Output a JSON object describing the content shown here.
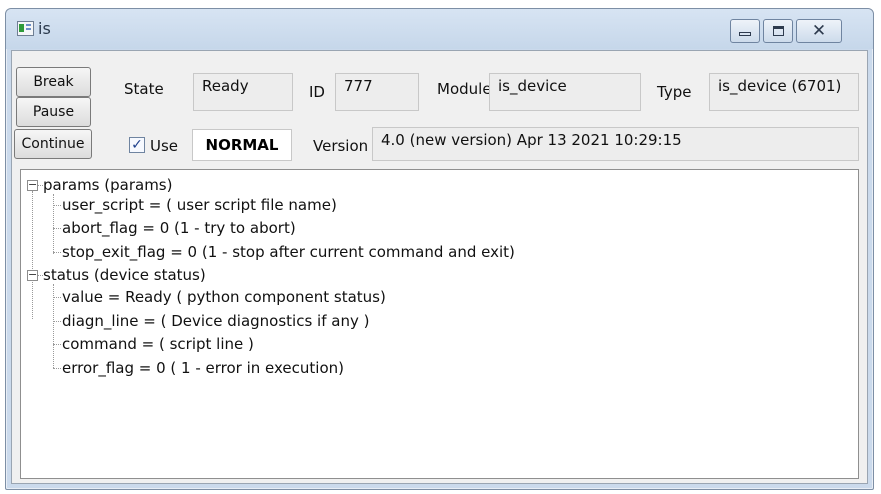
{
  "window": {
    "title": "is",
    "icons": {
      "app": "app-icon",
      "minimize": "minimize-icon",
      "maximize": "maximize-icon",
      "close": "close-icon"
    }
  },
  "toolbar": {
    "break_label": "Break",
    "pause_label": "Pause",
    "continue_label": "Continue"
  },
  "info": {
    "state_label": "State",
    "state_value": "Ready",
    "id_label": "ID",
    "id_value": "777",
    "module_label": "Module",
    "module_value": "is_device",
    "type_label": "Type",
    "type_value": "is_device (6701)",
    "use_label": "Use",
    "use_checked": true,
    "mode_value": "NORMAL",
    "version_label": "Version",
    "version_value": "4.0 (new version) Apr 13 2021  10:29:15"
  },
  "tree": {
    "groups": [
      {
        "label": "params (params)",
        "children": [
          "user_script =  ( user script file name)",
          "abort_flag = 0 (1 - try to abort)",
          "stop_exit_flag = 0 (1 - stop after current command and exit)"
        ]
      },
      {
        "label": "status (device status)",
        "children": [
          "value = Ready ( python component status)",
          "diagn_line =  ( Device diagnostics if any )",
          "command =  ( script line )",
          "error_flag = 0 ( 1 - error in execution)"
        ]
      }
    ]
  },
  "colors": {
    "frame": "#cbdaec",
    "client": "#f0f0f0",
    "tree_bg": "#ffffff"
  }
}
